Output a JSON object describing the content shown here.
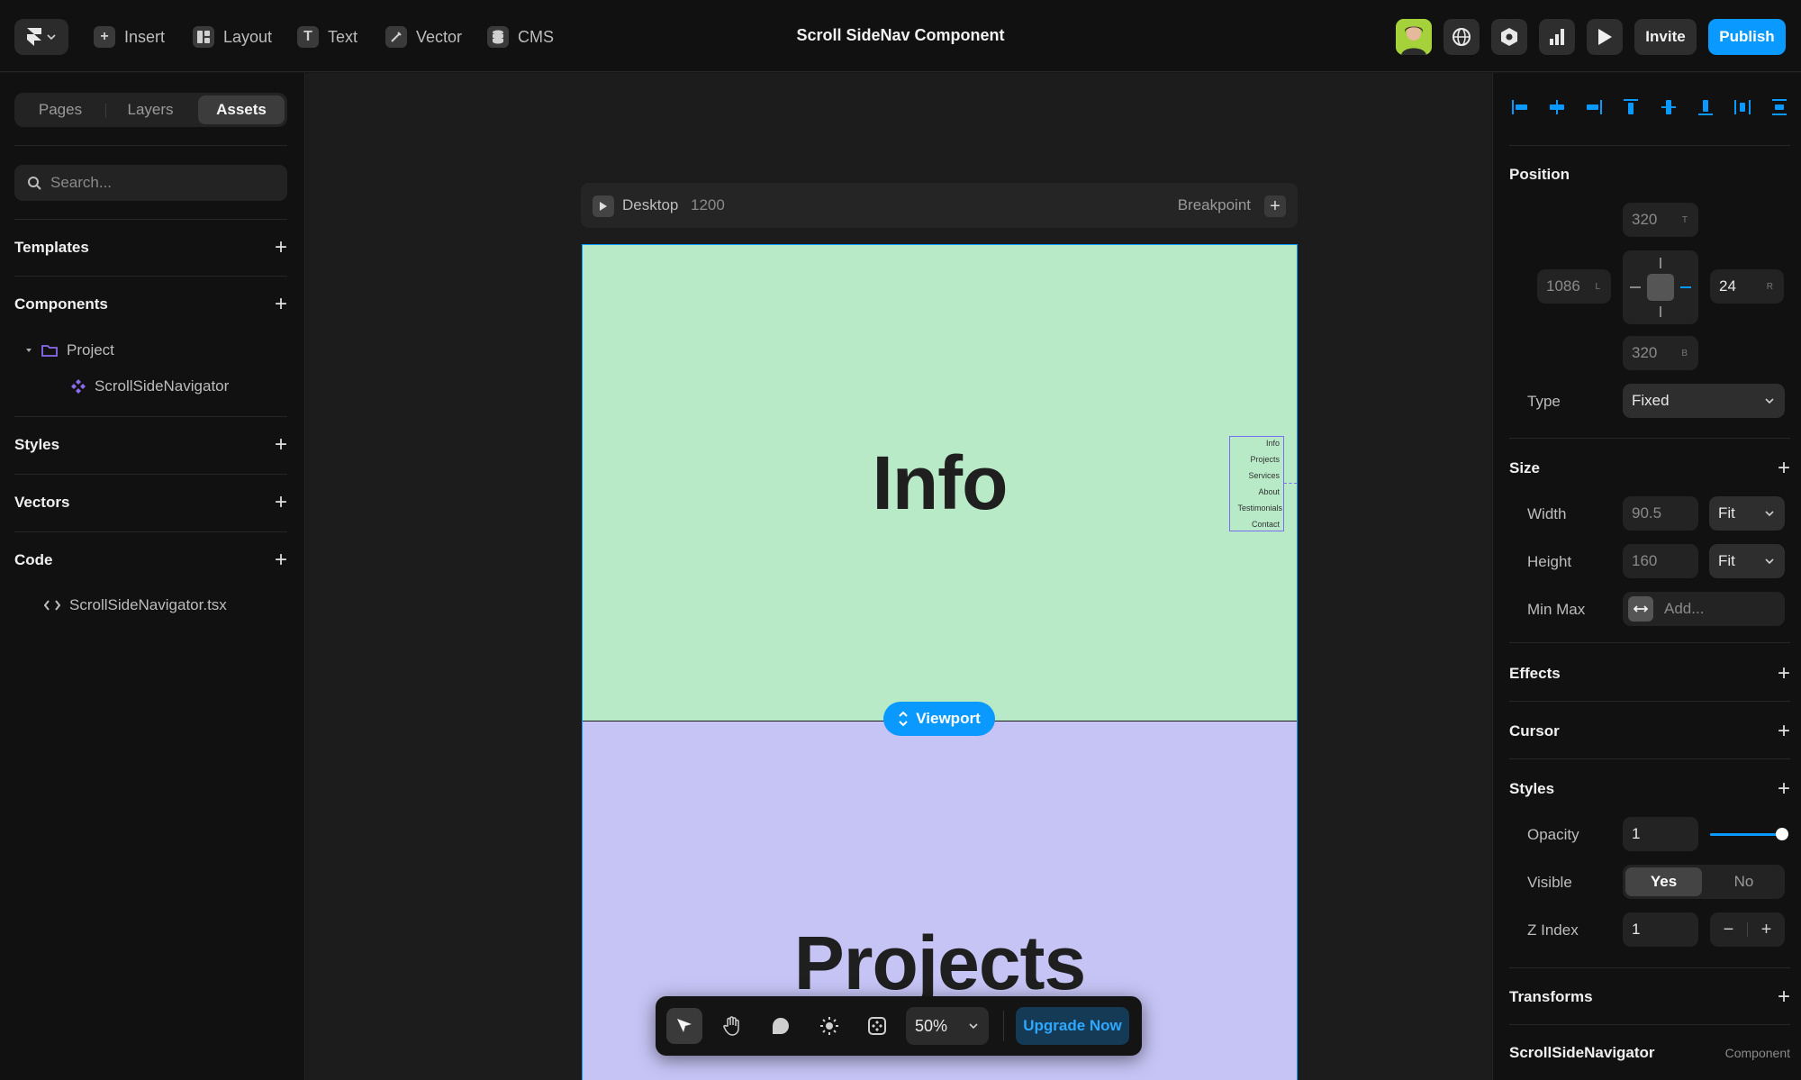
{
  "app": {
    "title": "Scroll SideNav Component",
    "menu": [
      {
        "label": "Insert",
        "icon": "plus-square-icon"
      },
      {
        "label": "Layout",
        "icon": "layout-icon"
      },
      {
        "label": "Text",
        "icon": "text-icon"
      },
      {
        "label": "Vector",
        "icon": "pen-icon"
      },
      {
        "label": "CMS",
        "icon": "database-icon"
      }
    ],
    "invite_label": "Invite",
    "publish_label": "Publish",
    "accent": "#0a99ff"
  },
  "left_panel": {
    "tabs": [
      "Pages",
      "Layers",
      "Assets"
    ],
    "active_tab": "Assets",
    "search_placeholder": "Search...",
    "sections": {
      "templates": "Templates",
      "components": "Components",
      "styles": "Styles",
      "vectors": "Vectors",
      "code": "Code"
    },
    "project_folder": "Project",
    "component_item": "ScrollSideNavigator",
    "code_file": "ScrollSideNavigator.tsx"
  },
  "canvas": {
    "breakpoint_name": "Desktop",
    "breakpoint_width": "1200",
    "breakpoint_label": "Breakpoint",
    "info_heading": "Info",
    "projects_heading": "Projects",
    "info_bg": "#b8eac8",
    "projects_bg": "#c6c4f5",
    "nav_items": [
      "Info",
      "Projects",
      "Services",
      "About",
      "Testimonials",
      "Contact"
    ],
    "viewport_label": "Viewport"
  },
  "bottom_toolbar": {
    "zoom": "50%",
    "upgrade_label": "Upgrade Now"
  },
  "right_panel": {
    "position": {
      "heading": "Position",
      "top": "320",
      "top_tag": "T",
      "left": "1086",
      "left_tag": "L",
      "right": "24",
      "right_tag": "R",
      "bottom": "320",
      "bottom_tag": "B",
      "type_label": "Type",
      "type_value": "Fixed"
    },
    "size": {
      "heading": "Size",
      "width_label": "Width",
      "width_value": "90.5",
      "width_mode": "Fit",
      "height_label": "Height",
      "height_value": "160",
      "height_mode": "Fit",
      "minmax_label": "Min Max",
      "minmax_placeholder": "Add..."
    },
    "effects_heading": "Effects",
    "cursor_heading": "Cursor",
    "styles": {
      "heading": "Styles",
      "opacity_label": "Opacity",
      "opacity_value": "1",
      "opacity_level": 1.0,
      "visible_label": "Visible",
      "visible_yes": "Yes",
      "visible_no": "No",
      "zindex_label": "Z Index",
      "zindex_value": "1"
    },
    "transforms_heading": "Transforms",
    "component_name": "ScrollSideNavigator",
    "component_tag": "Component"
  }
}
